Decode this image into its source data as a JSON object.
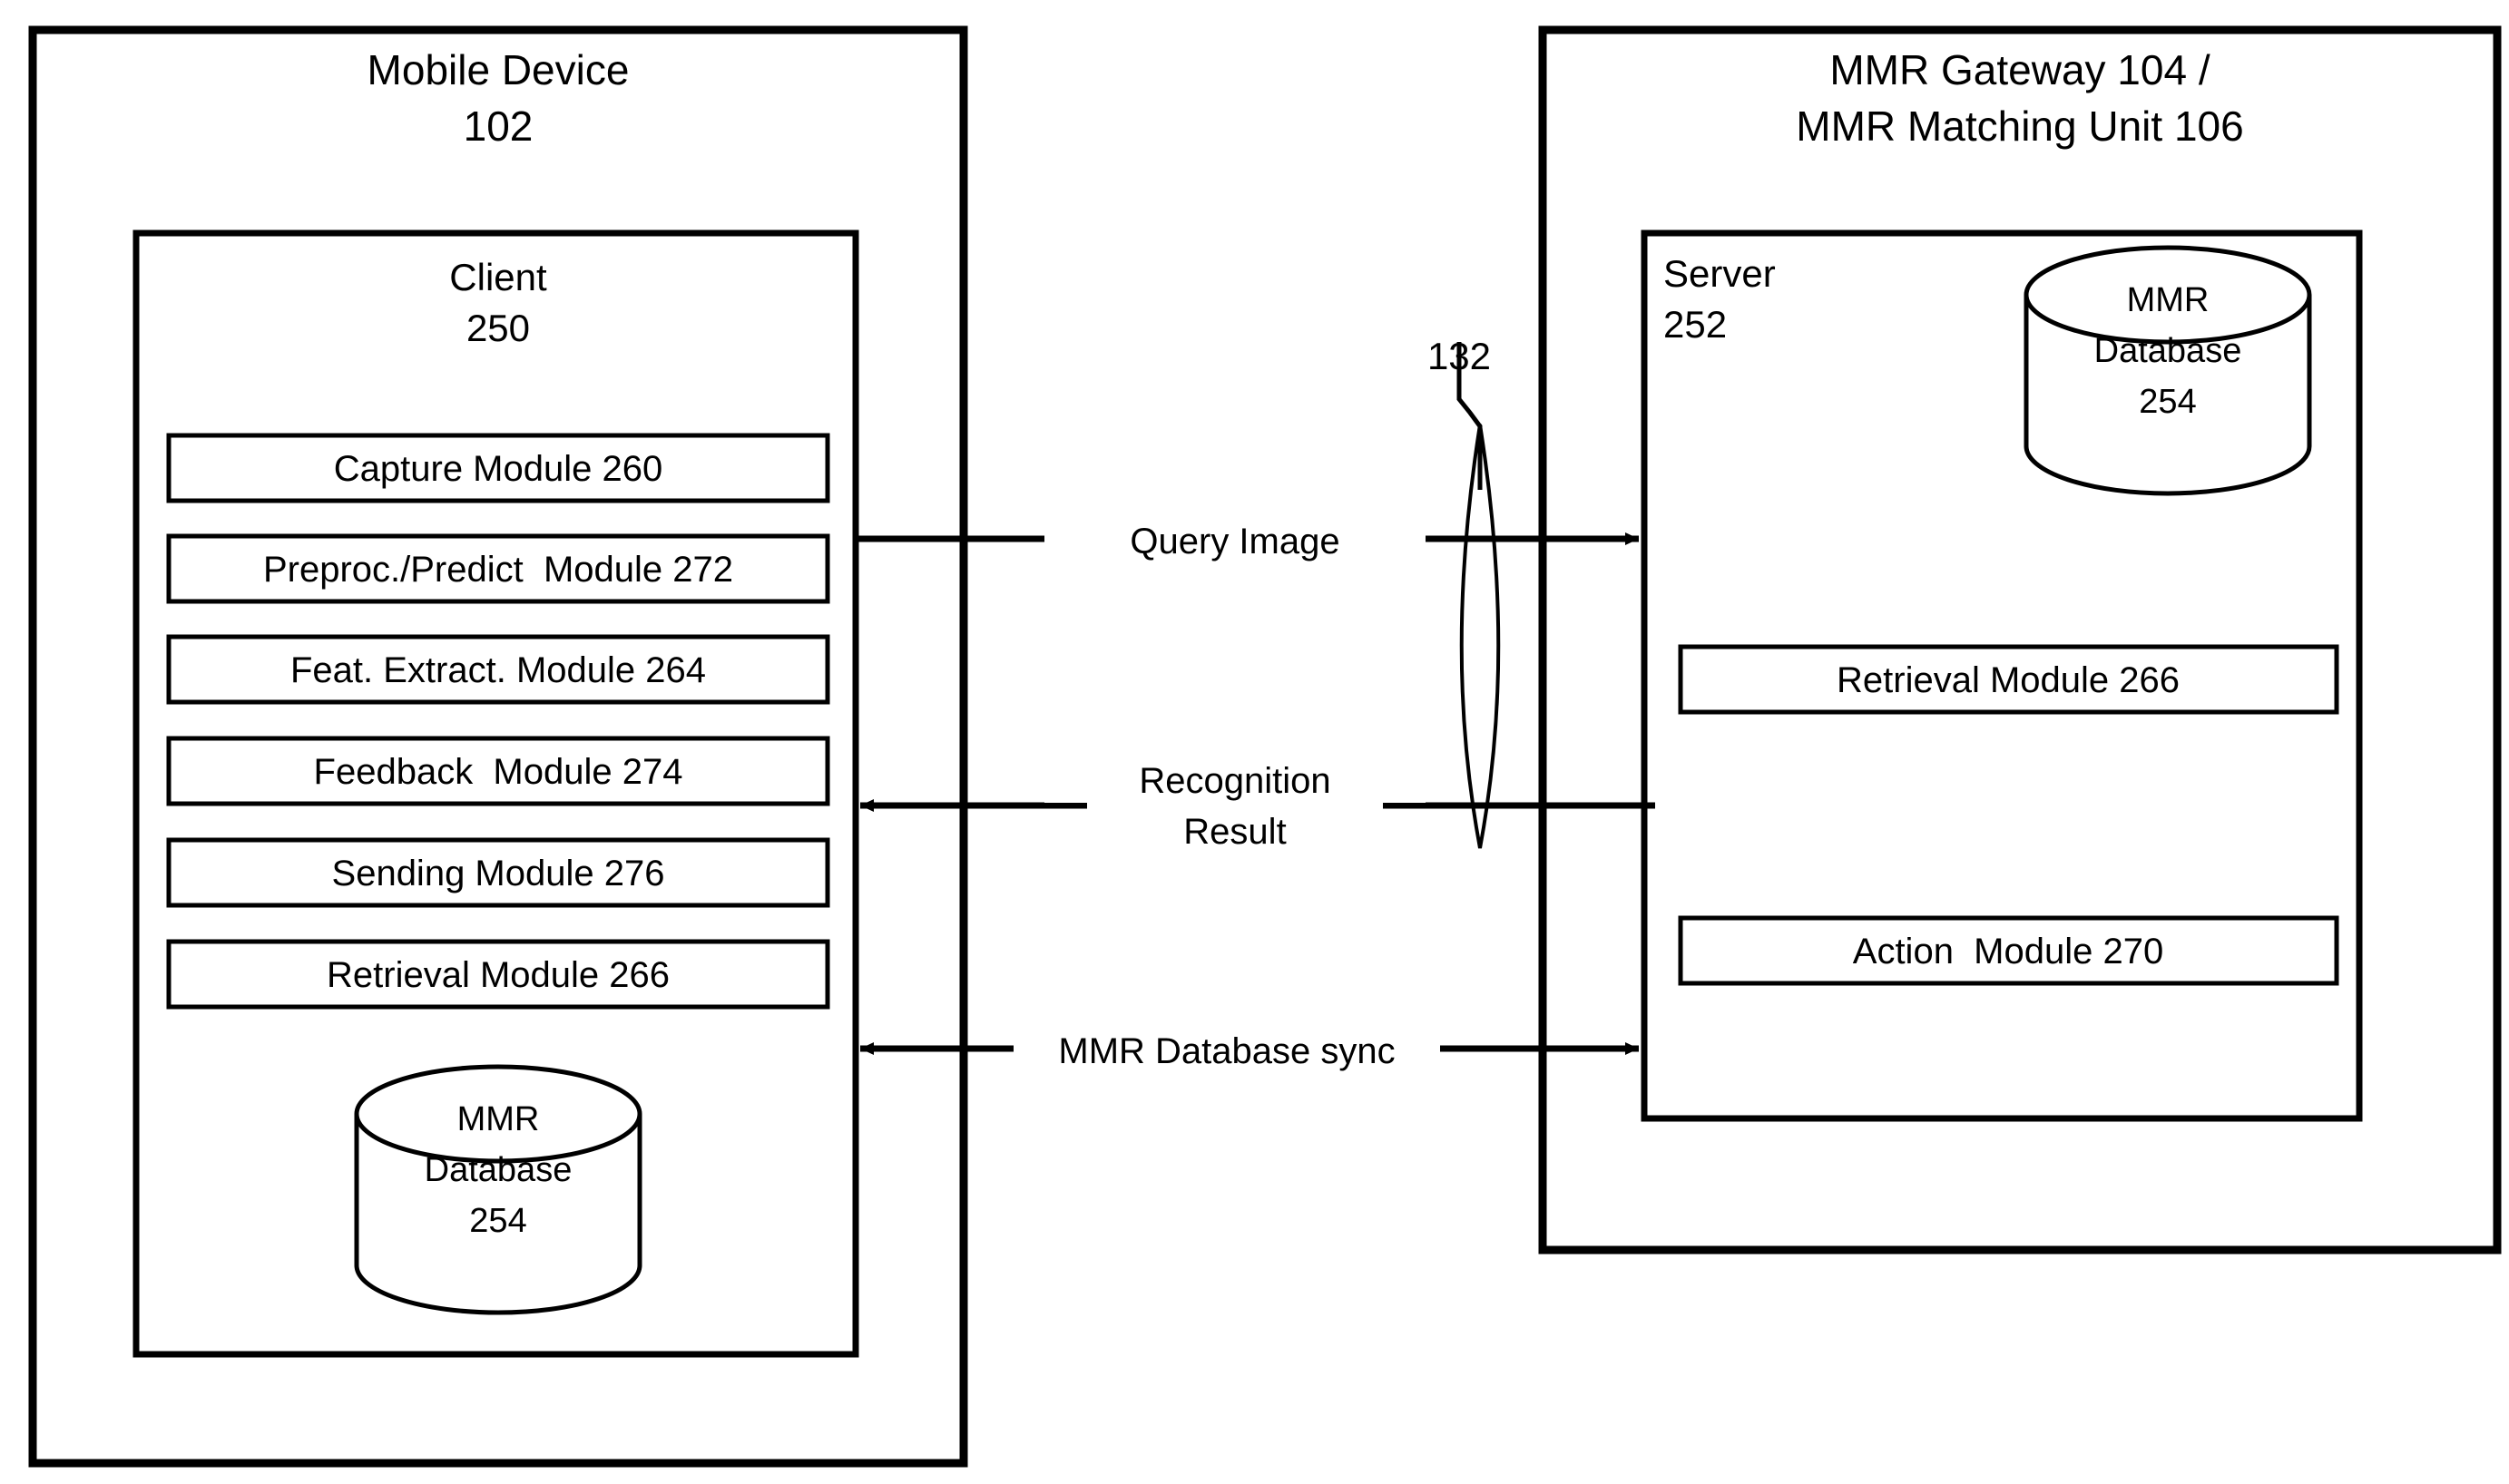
{
  "diagram": {
    "title": "MMR client-server architecture block diagram",
    "stroke_color": "#000000",
    "background_color": "#ffffff"
  },
  "left_panel": {
    "title_line1": "Mobile Device",
    "title_line2": "102",
    "inner": {
      "title_line1": "Client",
      "title_line2": "250",
      "modules": [
        {
          "label": "Capture Module 260"
        },
        {
          "label": "Preproc./Predict  Module 272"
        },
        {
          "label": "Feat. Extract. Module 264"
        },
        {
          "label": "Feedback  Module 274"
        },
        {
          "label": "Sending Module 276"
        },
        {
          "label": "Retrieval Module 266"
        }
      ],
      "database": {
        "line1": "MMR",
        "line2": "Database",
        "line3": "254"
      }
    }
  },
  "right_panel": {
    "title_line1": "MMR Gateway 104 /",
    "title_line2": "MMR Matching Unit 106",
    "inner": {
      "title_line1": "Server",
      "title_line2": "252",
      "modules": [
        {
          "label": "Retrieval Module 266"
        },
        {
          "label": "Action  Module 270"
        }
      ],
      "database": {
        "line1": "MMR",
        "line2": "Database",
        "line3": "254"
      }
    }
  },
  "connections": {
    "network_ref": "132",
    "flows": [
      {
        "label": "Query Image",
        "direction": "right"
      },
      {
        "label_line1": "Recognition",
        "label_line2": "Result",
        "direction": "left"
      },
      {
        "label": "MMR Database sync",
        "direction": "both"
      }
    ]
  }
}
